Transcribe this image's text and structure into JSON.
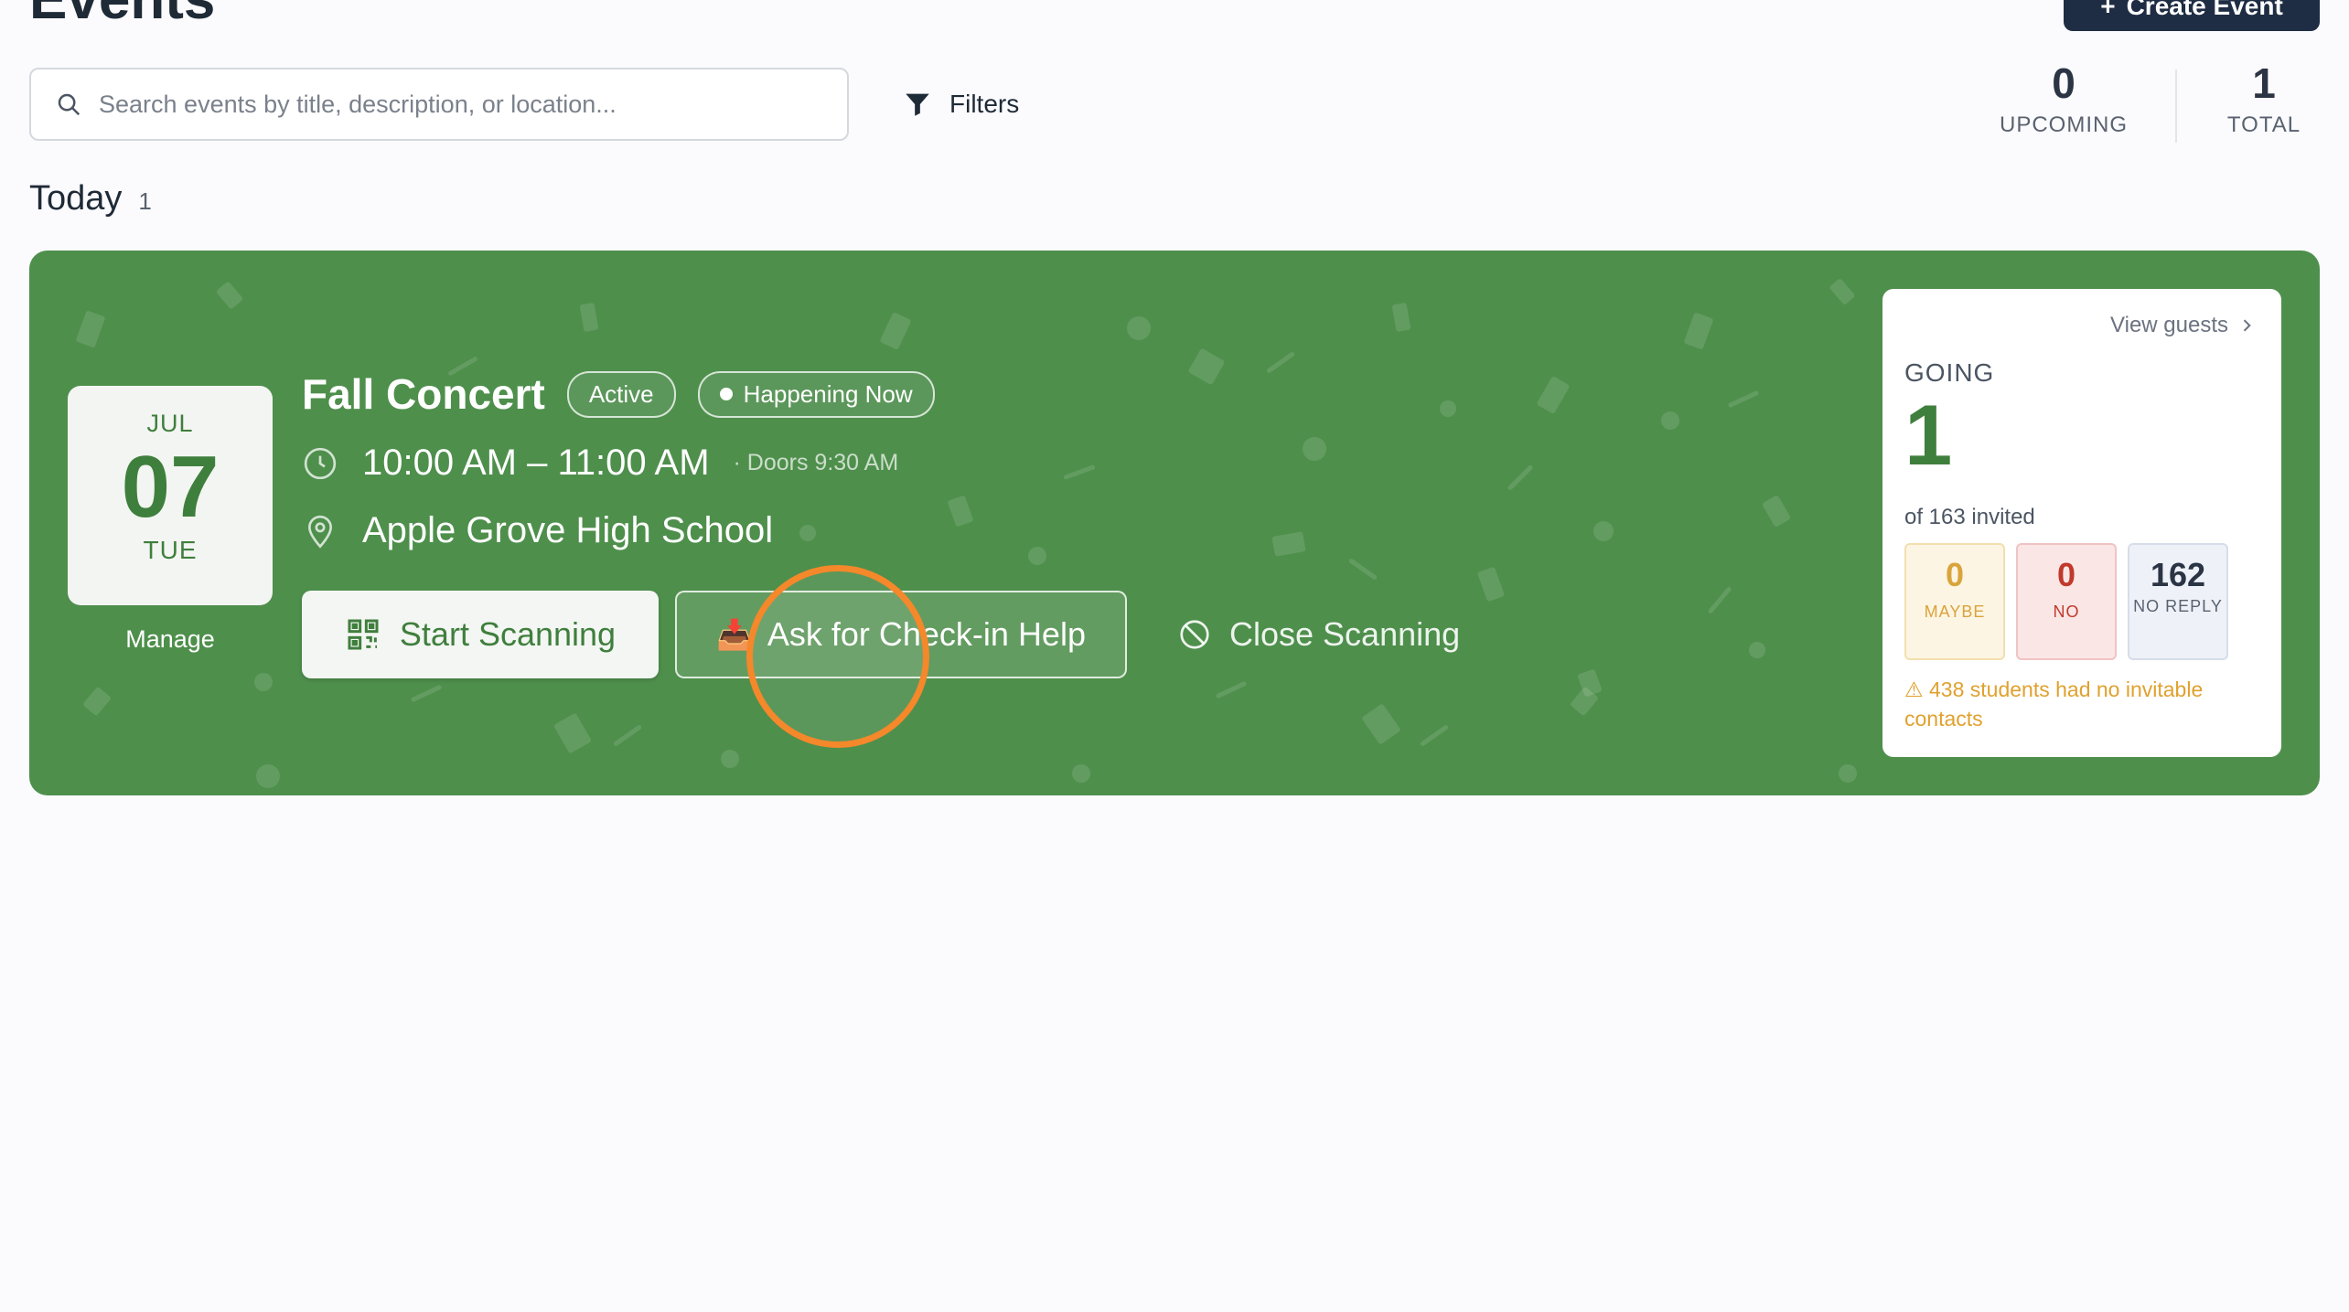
{
  "page": {
    "title": "Events",
    "create_label": "Create Event",
    "search_placeholder": "Search events by title, description, or location...",
    "filters_label": "Filters",
    "stats": [
      {
        "value": "0",
        "label": "UPCOMING"
      },
      {
        "value": "1",
        "label": "TOTAL"
      }
    ],
    "section": {
      "title": "Today",
      "count": "1"
    }
  },
  "event": {
    "month": "JUL",
    "day": "07",
    "weekday": "TUE",
    "manage_label": "Manage",
    "title": "Fall Concert",
    "status_badge": "Active",
    "live_badge": "Happening Now",
    "time": "10:00 AM – 11:00 AM",
    "doors": "· Doors 9:30 AM",
    "location": "Apple Grove High School",
    "start_scanning_label": "Start Scanning",
    "help_label": "Ask for Check-in Help",
    "help_emoji": "📥",
    "close_scanning_label": "Close Scanning",
    "accent_color": "#4e8f4c"
  },
  "rsvp": {
    "view_guests_label": "View guests",
    "going_label": "GOING",
    "going_count": "1",
    "invited_text": "of 163 invited",
    "maybe": {
      "value": "0",
      "label": "MAYBE"
    },
    "no": {
      "value": "0",
      "label": "NO"
    },
    "no_reply": {
      "value": "162",
      "label": "NO REPLY"
    },
    "warning": "⚠ 438 students had no invitable contacts"
  },
  "icons": [
    "plus-icon",
    "search-icon",
    "filter-icon",
    "clock-icon",
    "map-pin-icon",
    "qr-code-icon",
    "inbox-tray-icon",
    "no-entry-icon",
    "chevron-right-icon"
  ]
}
